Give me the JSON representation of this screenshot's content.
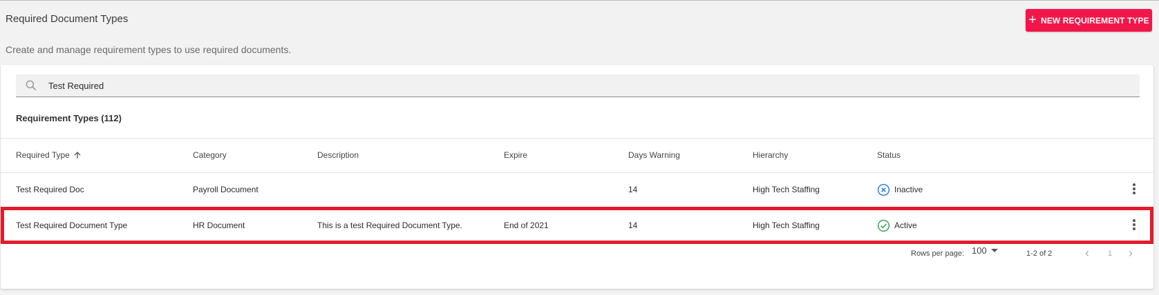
{
  "page": {
    "title": "Required Document Types",
    "subtitle": "Create and manage requirement types to use required documents.",
    "new_button_label": "NEW REQUIREMENT TYPE"
  },
  "search": {
    "value": "Test Required",
    "icon": "search-icon"
  },
  "table": {
    "section_title": "Requirement Types (112)",
    "columns": [
      "Required Type",
      "Category",
      "Description",
      "Expire",
      "Days Warning",
      "Hierarchy",
      "Status"
    ],
    "sort_column": "Required Type",
    "sort_direction": "ascending",
    "rows": [
      {
        "required_type": "Test Required Doc",
        "category": "Payroll Document",
        "description": "",
        "expire": "",
        "days_warning": "14",
        "hierarchy": "High Tech Staffing",
        "status": "Inactive",
        "highlighted": false
      },
      {
        "required_type": "Test Required Document Type",
        "category": "HR Document",
        "description": "This is a test Required Document Type.",
        "expire": "End of 2021",
        "days_warning": "14",
        "hierarchy": "High Tech Staffing",
        "status": "Active",
        "highlighted": true
      }
    ]
  },
  "pagination": {
    "rows_per_page_label": "Rows per page:",
    "rows_per_page": "100",
    "range": "1-2 of 2",
    "current_page": "1"
  },
  "colors": {
    "accent": "#f2174a",
    "active": "#3aa757",
    "inactive": "#2f7fe0",
    "highlight": "#e31b2b"
  }
}
